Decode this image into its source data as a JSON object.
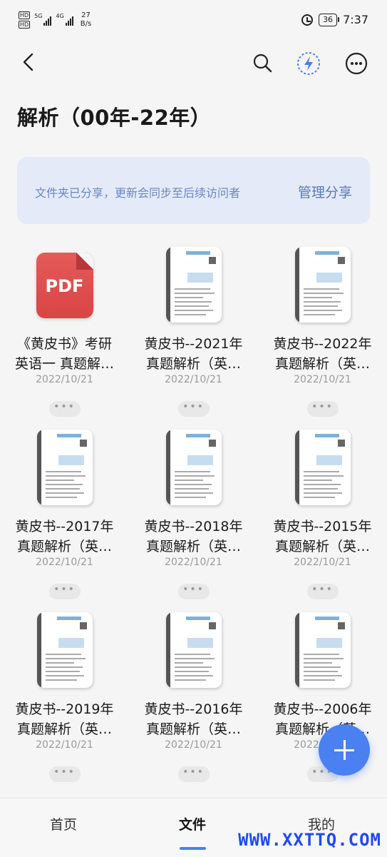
{
  "status_bar": {
    "sim1": "HD",
    "sim2": "HD",
    "net1": "5G",
    "net2": "4G",
    "speed_value": "27",
    "speed_unit": "B/s",
    "battery": "36",
    "time": "7:37"
  },
  "toolbar": {
    "back_icon": "chevron-left-icon",
    "search_icon": "search-icon",
    "bolt_icon": "lightning-icon",
    "more_icon": "more-icon"
  },
  "page_title": "解析（00年-22年）",
  "share_banner": {
    "text": "文件夹已分享，更新会同步至后续访问者",
    "link": "管理分享"
  },
  "files": [
    {
      "line1": "《黄皮书》考研",
      "line2": "英语一 真题解…",
      "date": "2022/10/21",
      "type": "pdf",
      "icon_label": "PDF"
    },
    {
      "line1": "黄皮书--2021年",
      "line2": "真题解析（英…",
      "date": "2022/10/21",
      "type": "doc"
    },
    {
      "line1": "黄皮书--2022年",
      "line2": "真题解析（英…",
      "date": "2022/10/21",
      "type": "doc"
    },
    {
      "line1": "黄皮书--2017年",
      "line2": "真题解析（英…",
      "date": "2022/10/21",
      "type": "doc"
    },
    {
      "line1": "黄皮书--2018年",
      "line2": "真题解析（英…",
      "date": "2022/10/21",
      "type": "doc"
    },
    {
      "line1": "黄皮书--2015年",
      "line2": "真题解析（英…",
      "date": "2022/10/21",
      "type": "doc"
    },
    {
      "line1": "黄皮书--2019年",
      "line2": "真题解析（英…",
      "date": "2022/10/21",
      "type": "doc"
    },
    {
      "line1": "黄皮书--2016年",
      "line2": "真题解析（英…",
      "date": "2022/10/21",
      "type": "doc"
    },
    {
      "line1": "黄皮书--2006年",
      "line2": "真题解析（英…",
      "date": "2022/10/21",
      "type": "doc"
    }
  ],
  "more_dots": "•••",
  "fab_icon": "plus-icon",
  "bottom_nav": {
    "home": "首页",
    "files": "文件",
    "mine": "我的"
  },
  "watermark": "WWW.XXTTQ.COM",
  "colors": {
    "accent": "#4a80f0",
    "banner_bg": "#e4eaf8",
    "pdf_red": "#e05050"
  }
}
